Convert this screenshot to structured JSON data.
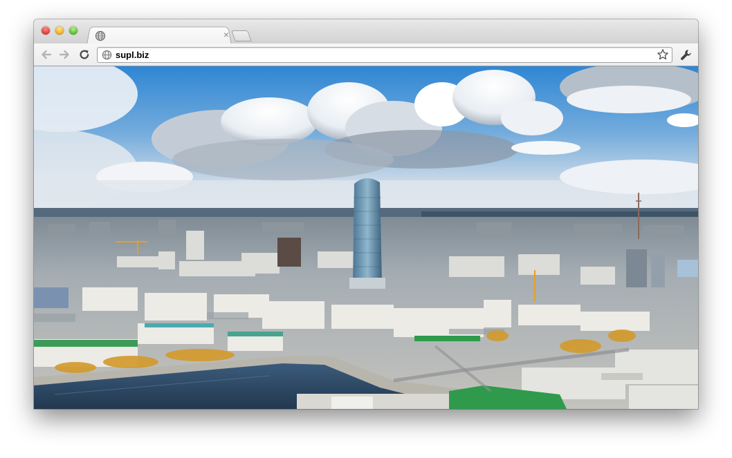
{
  "window": {
    "controls": [
      "close",
      "minimize",
      "zoom"
    ]
  },
  "tab": {
    "favicon": "globe-icon",
    "close_glyph": "×"
  },
  "toolbar": {
    "back_icon": "back-arrow-icon",
    "forward_icon": "forward-arrow-icon",
    "reload_icon": "reload-icon",
    "menu_icon": "wrench-icon"
  },
  "address_bar": {
    "url": "supl.biz",
    "site_icon": "globe-icon",
    "bookmark_icon": "star-icon"
  },
  "content": {
    "image": "city-panorama-photo"
  },
  "colors": {
    "sky_top": "#3d8fd8",
    "sky_horizon": "#dfe6ee",
    "river": "#2d4b6b",
    "roof_green": "#2f9a4c"
  }
}
